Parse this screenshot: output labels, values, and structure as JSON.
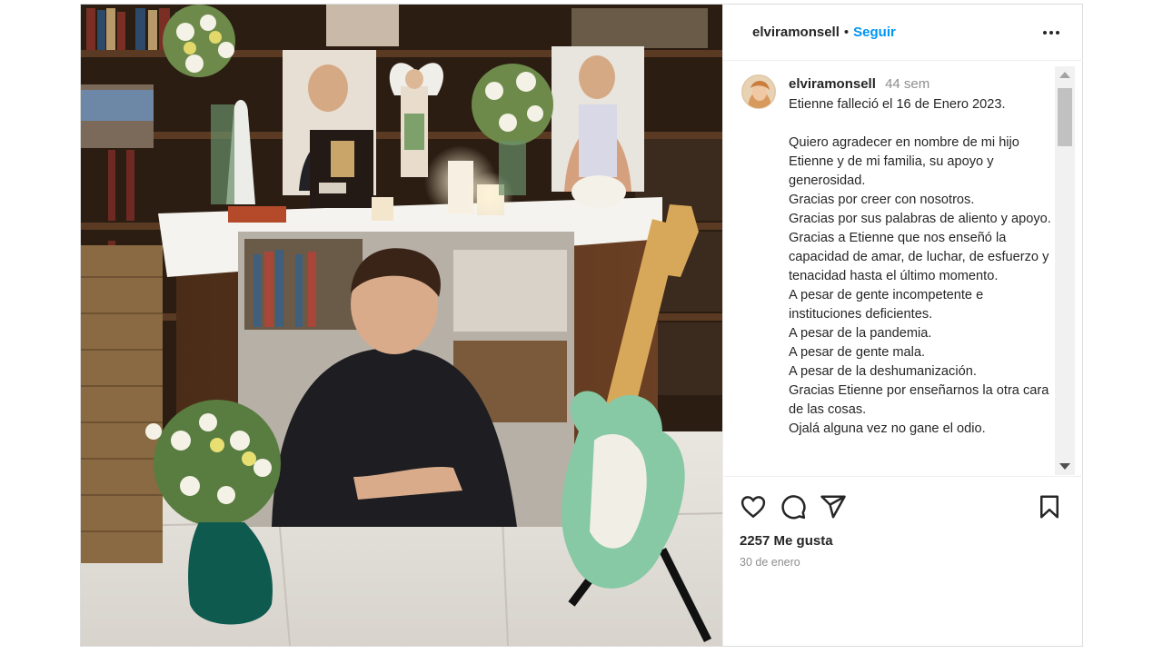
{
  "post": {
    "username": "elviramonsell",
    "follow_label": "Seguir",
    "separator": "•",
    "caption_username": "elviramonsell",
    "time_ago": "44 sem",
    "caption": "Etienne falleció el 16 de Enero 2023.\n\nQuiero agradecer en nombre de mi hijo Etienne y de mi familia, su apoyo y generosidad.\nGracias por creer con nosotros.\nGracias por sus palabras de aliento y apoyo.\nGracias a Etienne que nos enseñó la capacidad de amar, de luchar, de esfuerzo y tenacidad hasta el último momento.\nA pesar de gente incompetente e instituciones deficientes.\nA pesar de la pandemia.\nA pesar de gente mala.\nA pesar de la deshumanización.\nGracias Etienne por enseñarnos la otra cara de las cosas.\nOjalá alguna vez no gane el odio.",
    "likes": "2257 Me gusta",
    "date": "30 de enero"
  },
  "icons": {
    "more": "more-options-icon",
    "like": "heart-icon",
    "comment": "comment-icon",
    "share": "share-icon",
    "save": "bookmark-icon"
  },
  "colors": {
    "follow": "#0095f6",
    "text": "#262626",
    "muted": "#8e8e8e",
    "guitar": "#86c9a4",
    "vase": "#0f5a4f"
  }
}
